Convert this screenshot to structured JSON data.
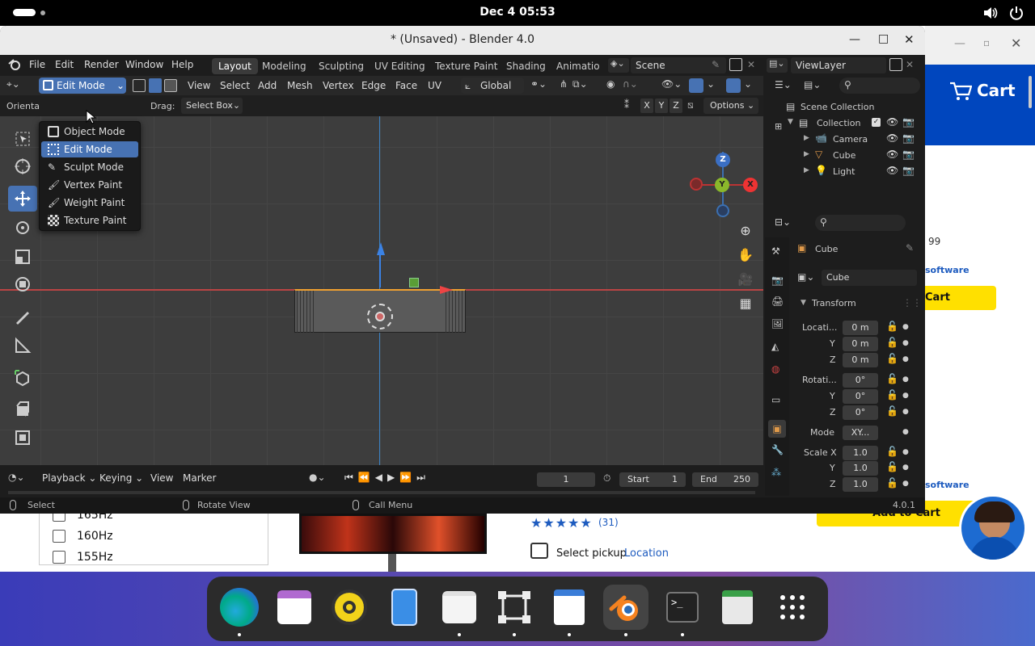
{
  "system": {
    "clock": "Dec 4  05:53"
  },
  "browser": {
    "cart_label": "Cart",
    "price_fragment": "99",
    "software_link_1": "software",
    "add_to_cart_fragment": "Cart",
    "software_link_2": "software",
    "add_to_cart_button": "Add to Cart",
    "refresh_rates": [
      "165Hz",
      "160Hz",
      "155Hz"
    ],
    "rating_count": "(31)",
    "pickup_text": "Select pickup",
    "pickup_link": "Location"
  },
  "blender": {
    "window_title": "* (Unsaved) - Blender 4.0",
    "menu": [
      "File",
      "Edit",
      "Render",
      "Window",
      "Help"
    ],
    "workspaces": [
      "Layout",
      "Modeling",
      "Sculpting",
      "UV Editing",
      "Texture Paint",
      "Shading",
      "Animation"
    ],
    "active_workspace": "Layout",
    "scene": "Scene",
    "view_layer": "ViewLayer",
    "mode_button": "Edit Mode",
    "header_menus": [
      "View",
      "Select",
      "Add",
      "Mesh",
      "Vertex",
      "Edge",
      "Face",
      "UV"
    ],
    "orientation": "Global",
    "subheader": {
      "orientation_label": "Orienta",
      "drag_label": "Drag:",
      "drag_value": "Select Box",
      "axes": [
        "X",
        "Y",
        "Z"
      ],
      "options": "Options"
    },
    "mode_menu": {
      "items": [
        "Object Mode",
        "Edit Mode",
        "Sculpt Mode",
        "Vertex Paint",
        "Weight Paint",
        "Texture Paint"
      ],
      "highlighted": "Edit Mode"
    },
    "gizmo": {
      "x": "X",
      "y": "Y",
      "z": "Z"
    },
    "timeline": {
      "menus": [
        "Playback",
        "Keying",
        "View",
        "Marker"
      ],
      "current_frame": "1",
      "start_label": "Start",
      "start": "1",
      "end_label": "End",
      "end": "250"
    },
    "status": {
      "select": "Select",
      "rotate": "Rotate View",
      "call_menu": "Call Menu",
      "version": "4.0.1"
    },
    "outliner": {
      "root": "Scene Collection",
      "collection": "Collection",
      "objects": [
        "Camera",
        "Cube",
        "Light"
      ]
    },
    "properties": {
      "object_name": "Cube",
      "data_name": "Cube",
      "section": "Transform",
      "location_label": "Locati...",
      "location": [
        "0 m",
        "0 m",
        "0 m"
      ],
      "rotation_label": "Rotati...",
      "rotation": [
        "0°",
        "0°",
        "0°"
      ],
      "mode_label": "Mode",
      "mode_value": "XY...",
      "scale_label": "Scale X",
      "scale": [
        "1.0",
        "1.0",
        "1.0"
      ],
      "axis_y": "Y",
      "axis_z": "Z"
    }
  }
}
